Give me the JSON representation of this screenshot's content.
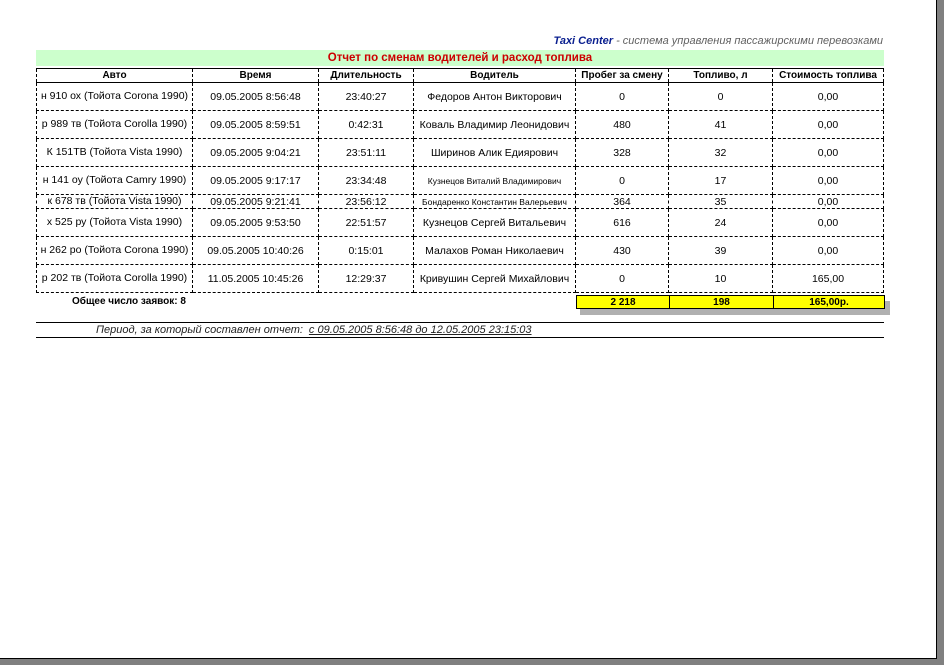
{
  "header": {
    "brand": "Taxi Center",
    "tagline": " - система управления пассажирскими перевозками"
  },
  "report": {
    "title": "Отчет по сменам водителей и расход топлива",
    "columns": [
      "Авто",
      "Время",
      "Длительность",
      "Водитель",
      "Пробег за смену",
      "Топливо, л",
      "Стоимость топлива"
    ],
    "rows": [
      {
        "auto": "н 910 ох (Тойота Corona 1990)",
        "time": "09.05.2005 8:56:48",
        "duration": "23:40:27",
        "driver": "Федоров Антон Викторович",
        "mileage": "0",
        "fuel": "0",
        "cost": "0,00"
      },
      {
        "auto": "р 989 тв (Тойота Corolla 1990)",
        "time": "09.05.2005 8:59:51",
        "duration": "0:42:31",
        "driver": "Коваль Владимир Леонидович",
        "mileage": "480",
        "fuel": "41",
        "cost": "0,00"
      },
      {
        "auto": "К 151ТВ (Тойота Vista 1990)",
        "time": "09.05.2005 9:04:21",
        "duration": "23:51:11",
        "driver": "Ширинов Алик Едиярович",
        "mileage": "328",
        "fuel": "32",
        "cost": "0,00"
      },
      {
        "auto": "н 141 оу (Тойота Camry 1990)",
        "time": "09.05.2005 9:17:17",
        "duration": "23:34:48",
        "driver": "Кузнецов Виталий Владимирович",
        "mileage": "0",
        "fuel": "17",
        "cost": "0,00"
      },
      {
        "auto": "к 678 тв (Тойота Vista 1990)",
        "time": "09.05.2005 9:21:41",
        "duration": "23:56:12",
        "driver": "Бондаренко Константин Валерьевич",
        "mileage": "364",
        "fuel": "35",
        "cost": "0,00"
      },
      {
        "auto": "х 525 ру (Тойота Vista 1990)",
        "time": "09.05.2005 9:53:50",
        "duration": "22:51:57",
        "driver": "Кузнецов Сергей Витальевич",
        "mileage": "616",
        "fuel": "24",
        "cost": "0,00"
      },
      {
        "auto": "н 262 ро (Тойота Corona 1990)",
        "time": "09.05.2005 10:40:26",
        "duration": "0:15:01",
        "driver": "Малахов Роман Николаевич",
        "mileage": "430",
        "fuel": "39",
        "cost": "0,00"
      },
      {
        "auto": "р 202 тв (Тойота Corolla 1990)",
        "time": "11.05.2005 10:45:26",
        "duration": "12:29:37",
        "driver": "Кривушин Сергей Михайлович",
        "mileage": "0",
        "fuel": "10",
        "cost": "165,00"
      }
    ],
    "totals": {
      "label": "Общее число заявок: 8",
      "mileage": "2 218",
      "fuel": "198",
      "cost": "165,00р."
    },
    "period": {
      "label": "Период, за который составлен отчет:",
      "value": "с 09.05.2005 8:56:48 до 12.05.2005 23:15:03"
    }
  },
  "colors": {
    "title_bg": "#ccffcc",
    "title_text": "#cc0000",
    "brand_text": "#0a1f8f",
    "totals_bg": "#ffff00"
  }
}
